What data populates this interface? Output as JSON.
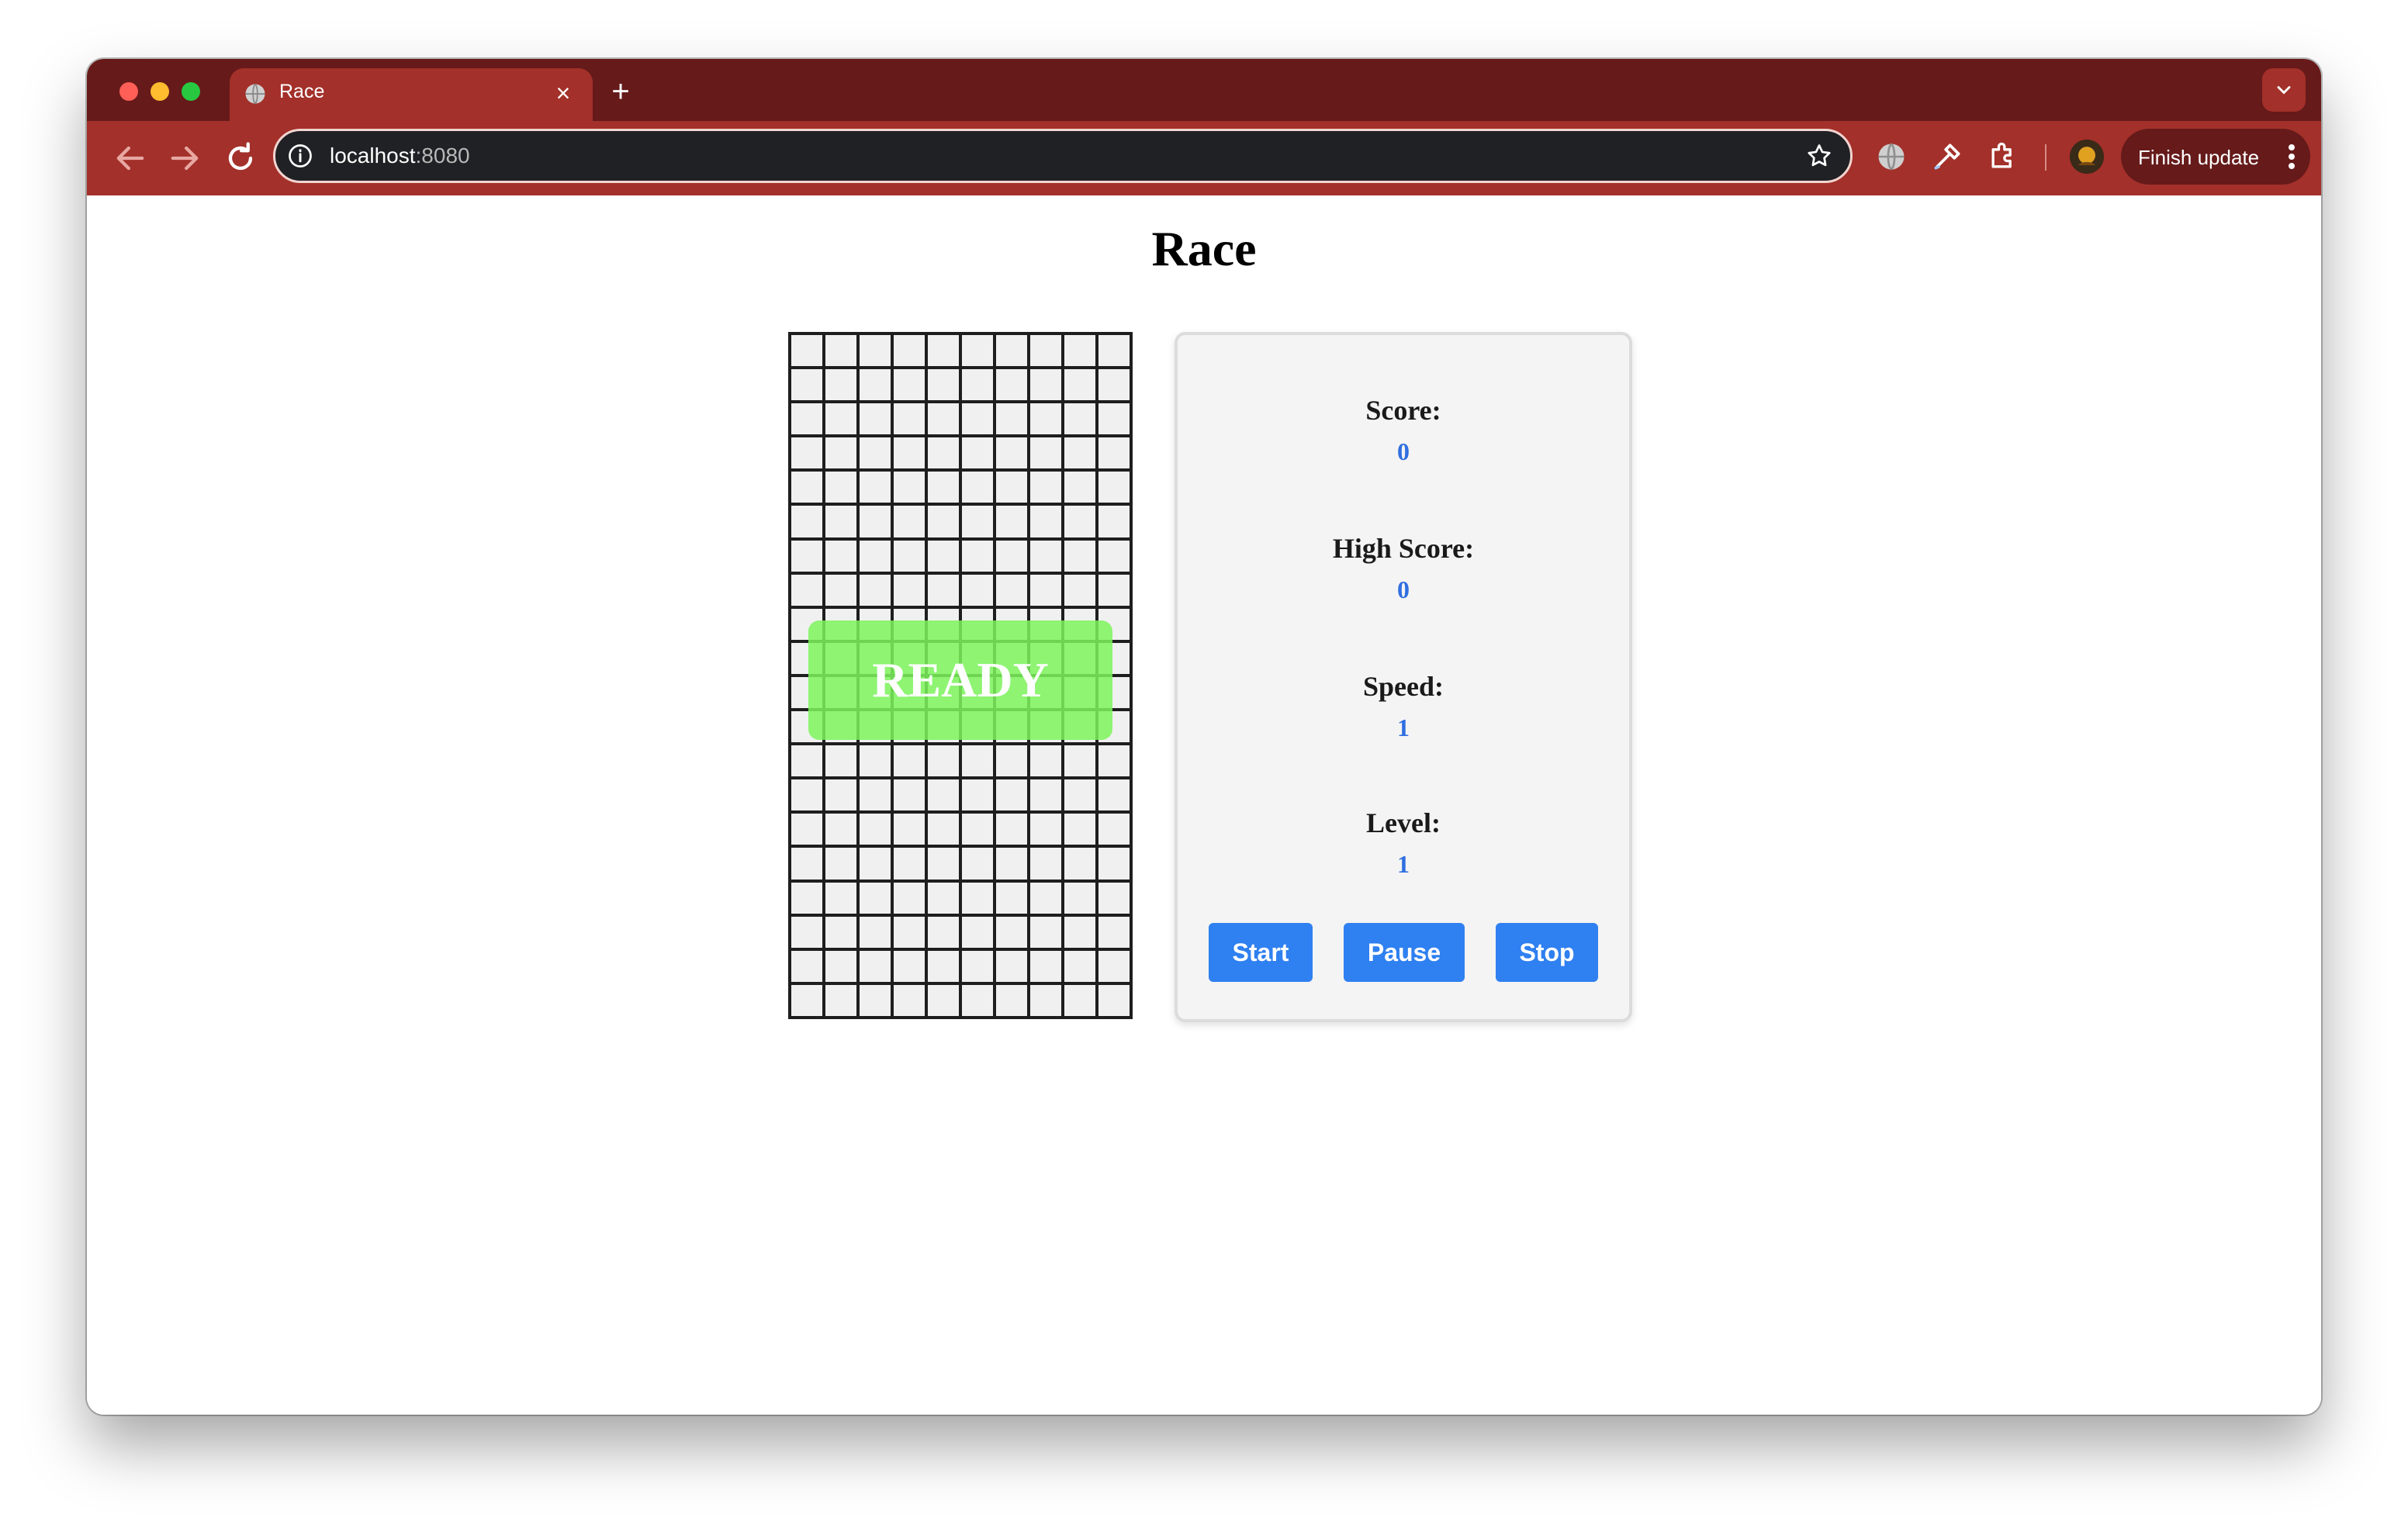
{
  "browser": {
    "tab_title": "Race",
    "url_host": "localhost",
    "url_port": ":8080",
    "finish_update_label": "Finish update",
    "theme_color": "#a3302a"
  },
  "page": {
    "title": "Race",
    "overlay_text": "READY",
    "overlay_color": "#7cf55c"
  },
  "stats": {
    "score_label": "Score:",
    "score_value": "0",
    "high_score_label": "High Score:",
    "high_score_value": "0",
    "speed_label": "Speed:",
    "speed_value": "1",
    "level_label": "Level:",
    "level_value": "1"
  },
  "controls": {
    "start_label": "Start",
    "pause_label": "Pause",
    "stop_label": "Stop",
    "button_color": "#2f80f0"
  }
}
